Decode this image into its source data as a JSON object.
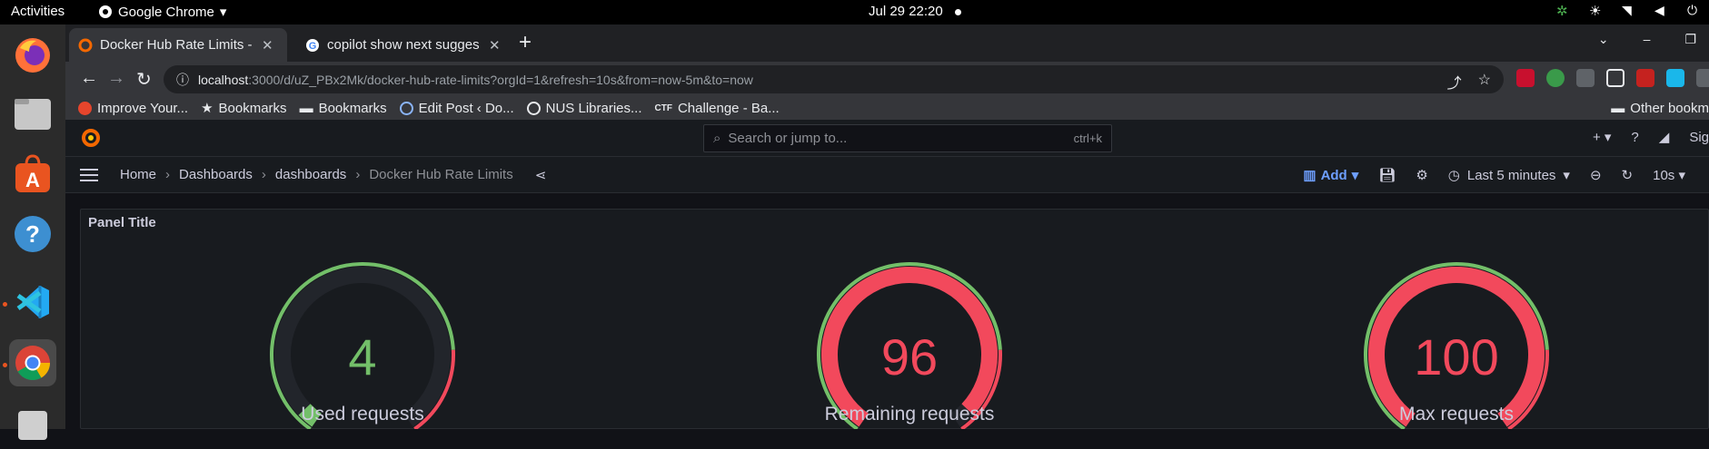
{
  "os": {
    "activities": "Activities",
    "app_name": "Google Chrome",
    "clock": "Jul 29  22:20"
  },
  "browser": {
    "tabs": [
      {
        "title": "Docker Hub Rate Limits - G",
        "active": true
      },
      {
        "title": "copilot show next sugges",
        "active": false
      }
    ],
    "url_host": "localhost",
    "url_rest": ":3000/d/uZ_PBx2Mk/docker-hub-rate-limits?orgId=1&refresh=10s&from=now-5m&to=now",
    "bookmarks": [
      "Improve Your...",
      "Bookmarks",
      "Bookmarks",
      "Edit Post ‹ Do...",
      "NUS Libraries...",
      "Challenge - Ba..."
    ],
    "other_bookmarks": "Other bookm"
  },
  "grafana": {
    "search_placeholder": "Search or jump to...",
    "search_shortcut": "ctrl+k",
    "sign_in": "Sig",
    "breadcrumbs": [
      "Home",
      "Dashboards",
      "dashboards",
      "Docker Hub Rate Limits"
    ],
    "add_label": "Add",
    "time_range": "Last 5 minutes",
    "refresh": "10s",
    "panel_title": "Panel Title",
    "gauges": [
      {
        "value": "4",
        "label": "Used requests",
        "fraction": 0.04,
        "color": "#73bf69"
      },
      {
        "value": "96",
        "label": "Remaining requests",
        "fraction": 0.96,
        "color": "#f2495c"
      },
      {
        "value": "100",
        "label": "Max requests",
        "fraction": 1.0,
        "color": "#f2495c"
      }
    ]
  }
}
